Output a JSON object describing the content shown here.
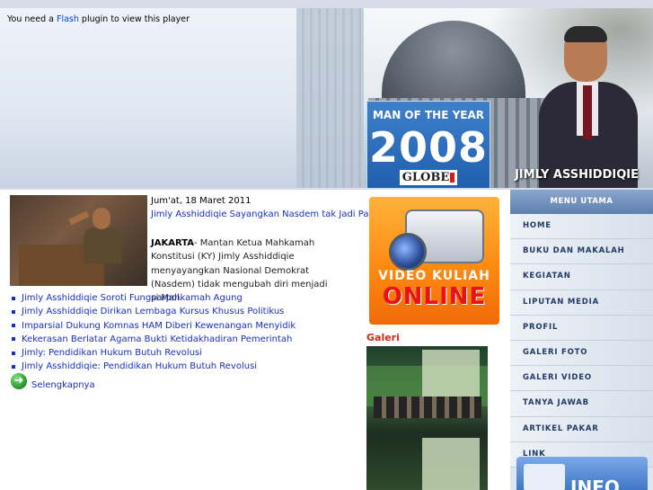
{
  "header": {
    "flash_prefix": "You need a ",
    "flash_link": "Flash",
    "flash_suffix": " plugin to view this player",
    "award_label": "MAN OF THE YEAR",
    "award_year": "2008",
    "award_brand": "GLOBE",
    "name_caption": "JIMLY ASSHIDDIQIE"
  },
  "news": {
    "date": "Jum'at, 18 Maret 2011",
    "headline": "Jimly Asshiddiqie Sayangkan Nasdem tak Jadi Parpol",
    "lead_city": "JAKARTA",
    "lead_text": "- Mantan Ketua Mahkamah Konstitusi (KY) Jimly Asshiddiqie menyayangkan Nasional Demokrat (Nasdem) tidak mengubah diri menjadi parpol.",
    "items": [
      "Jimly Asshiddiqie Soroti Fungsi Mahkamah Agung",
      "Jimly Asshiddiqie Dirikan Lembaga Kursus Khusus Politikus",
      "Imparsial Dukung Komnas HAM Diberi Kewenangan Menyidik",
      "Kekerasan Berlatar Agama Bukti Ketidakhadiran Pemerintah",
      "Jimly: Pendidikan Hukum Butuh Revolusi",
      "Jimly Asshiddiqie: Pendidikan Hukum Butuh Revolusi"
    ],
    "more_label": "Selengkapnya"
  },
  "video": {
    "line1": "VIDEO KULIAH",
    "line2": "ONLINE"
  },
  "galeri": {
    "title": "Galeri"
  },
  "menu": {
    "header": "MENU UTAMA",
    "items": [
      "HOME",
      "BUKU DAN MAKALAH",
      "KEGIATAN",
      "LIPUTAN MEDIA",
      "PROFIL",
      "GALERI FOTO",
      "GALERI VIDEO",
      "TANYA JAWAB",
      "ARTIKEL PAKAR",
      "LINK"
    ]
  },
  "info_banner": "INFO"
}
